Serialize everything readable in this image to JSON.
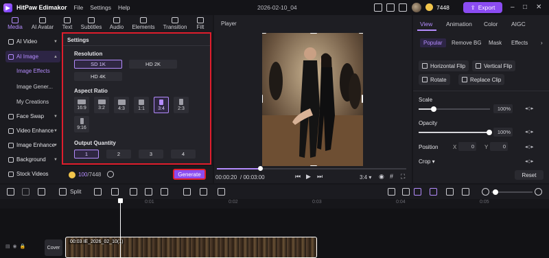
{
  "app": {
    "name": "HitPaw Edimakor",
    "menus": [
      "File",
      "Settings",
      "Help"
    ],
    "doc_title": "2026-02-10_04"
  },
  "account": {
    "coins": "7448",
    "export_label": "Export"
  },
  "tool_tabs": [
    {
      "label": "Media",
      "icon": "media-icon"
    },
    {
      "label": "AI Avatar",
      "icon": "ai-avatar-icon"
    },
    {
      "label": "Text",
      "icon": "text-icon"
    },
    {
      "label": "Subtitles",
      "icon": "subtitles-icon"
    },
    {
      "label": "Audio",
      "icon": "audio-icon"
    },
    {
      "label": "Elements",
      "icon": "elements-icon"
    },
    {
      "label": "Transition",
      "icon": "transition-icon"
    },
    {
      "label": "Filt",
      "icon": "filter-icon"
    }
  ],
  "sidebar": {
    "items": [
      {
        "label": "AI Video"
      },
      {
        "label": "AI Image"
      },
      {
        "label": "Face Swap"
      },
      {
        "label": "Video Enhance"
      },
      {
        "label": "Image Enhance"
      },
      {
        "label": "Background"
      },
      {
        "label": "Stock Videos"
      }
    ],
    "sub_items": [
      "Image Effects",
      "Image Gener...",
      "My Creations"
    ]
  },
  "settings": {
    "title": "Settings",
    "resolution_label": "Resolution",
    "resolutions": [
      "SD 1K",
      "HD 2K",
      "HD 4K"
    ],
    "selected_resolution": "SD 1K",
    "aspect_label": "Aspect Ratio",
    "aspect_ratios": [
      "16:9",
      "3:2",
      "4:3",
      "1:1",
      "3:4",
      "2:3",
      "9:16"
    ],
    "selected_aspect": "3:4",
    "quantity_label": "Output Quantity",
    "quantities": [
      "1",
      "2",
      "3",
      "4"
    ],
    "selected_quantity": "1"
  },
  "generate": {
    "credits_used": "100",
    "credits_total": "/7448",
    "button_label": "Generate"
  },
  "player": {
    "title": "Player",
    "current_time": "00:00:20",
    "total_time": "/ 00:03:00",
    "aspect": "3:4",
    "progress": 0.23
  },
  "right_panel": {
    "tabs": [
      "View",
      "Animation",
      "Color",
      "AIGC"
    ],
    "sub_tabs": [
      "Popular",
      "Remove BG",
      "Mask",
      "Effects"
    ],
    "buttons": [
      "Horizontal Flip",
      "Vertical Flip",
      "Rotate",
      "Replace Clip"
    ],
    "scale_label": "Scale",
    "scale_value": "100%",
    "opacity_label": "Opacity",
    "opacity_value": "100%",
    "position_label": "Position",
    "pos_x_label": "X",
    "pos_x": "0",
    "pos_y_label": "Y",
    "pos_y": "0",
    "crop_label": "Crop",
    "reset_label": "Reset"
  },
  "timeline": {
    "split_label": "Split",
    "ruler": [
      "0:01",
      "0:02",
      "0:03",
      "0:04",
      "0:05"
    ],
    "cover_label": "Cover",
    "clip_label": "00:03 IE_2026_02_10(1)"
  },
  "colors": {
    "accent": "#8b4cf2",
    "accent_light": "#b58cff",
    "highlight_border": "#e01d2c",
    "coin": "#f2c54b"
  }
}
